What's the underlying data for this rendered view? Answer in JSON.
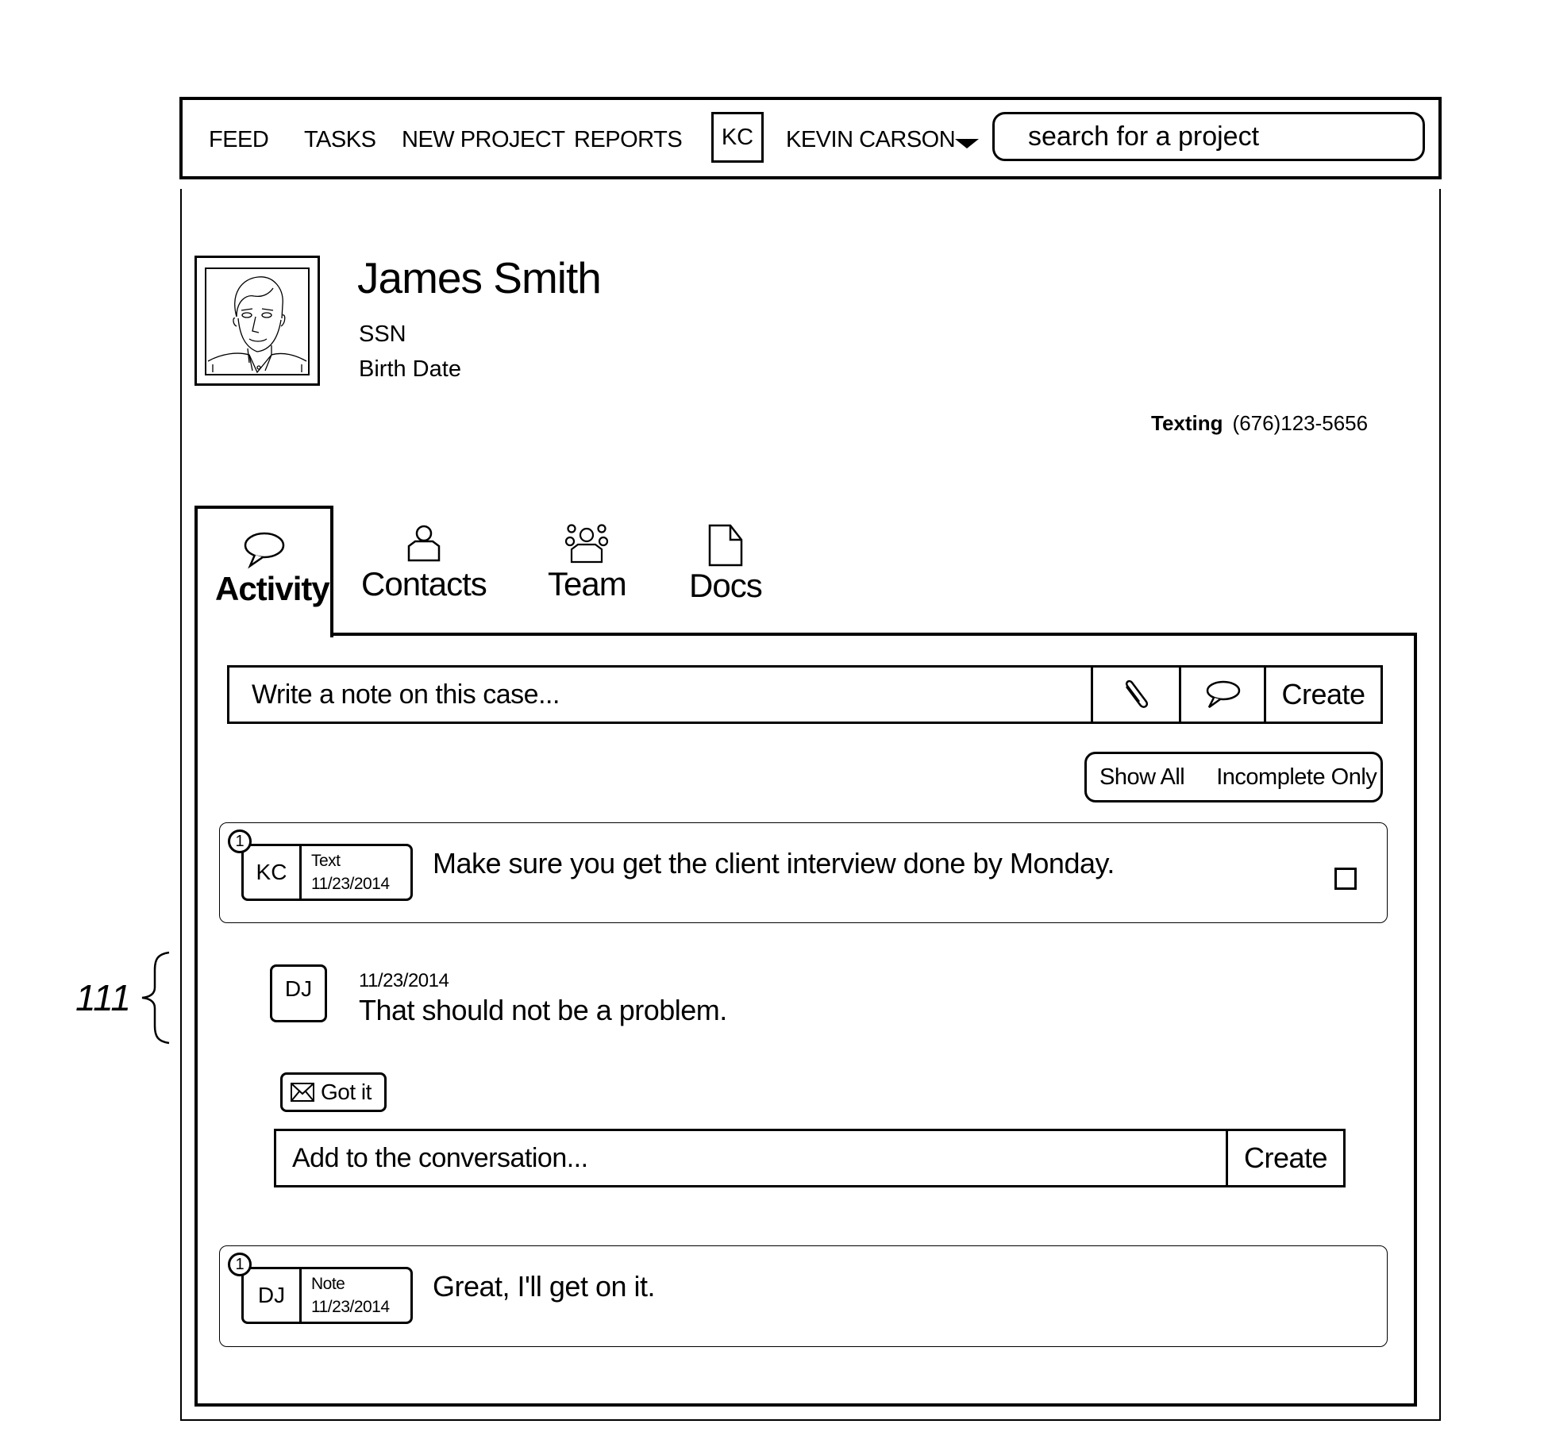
{
  "nav": {
    "items": [
      {
        "label": "FEED"
      },
      {
        "label": "TASKS"
      },
      {
        "label": "NEW PROJECT"
      },
      {
        "label": "REPORTS"
      }
    ],
    "user_initials": "KC",
    "user_name": "KEVIN CARSON",
    "user_menu_icon": "caret-down-icon",
    "search_placeholder": "search for a project"
  },
  "profile": {
    "name": "James Smith",
    "ssn_label": "SSN",
    "birth_date_label": "Birth Date",
    "avatar_icon": "person-portrait",
    "contact_method": "Texting",
    "phone": "(676)123-5656"
  },
  "tabs": [
    {
      "label": "Activity",
      "icon": "speech-bubble-icon",
      "active": true
    },
    {
      "label": "Contacts",
      "icon": "person-icon",
      "active": false
    },
    {
      "label": "Team",
      "icon": "group-icon",
      "active": false
    },
    {
      "label": "Docs",
      "icon": "document-icon",
      "active": false
    }
  ],
  "note": {
    "placeholder": "Write a note on this case...",
    "attach_icon": "paperclip-icon",
    "comment_icon": "speech-bubble-icon",
    "create_label": "Create"
  },
  "filter": {
    "show_all": "Show All",
    "incomplete_only": "Incomplete Only"
  },
  "activity": [
    {
      "count": "1",
      "initials": "KC",
      "type": "Text",
      "date": "11/23/2014",
      "message": "Make sure you get the client interview done by Monday.",
      "has_checkbox": true,
      "checked": false,
      "replies": [
        {
          "initials": "DJ",
          "date": "11/23/2014",
          "message": "That should not be a problem."
        }
      ],
      "ack_label": "Got it",
      "ack_icon": "envelope-icon",
      "reply_placeholder": "Add to the conversation...",
      "reply_create_label": "Create"
    },
    {
      "count": "1",
      "initials": "DJ",
      "type": "Note",
      "date": "11/23/2014",
      "message": "Great, I'll get on it."
    }
  ],
  "annotation": {
    "reference_label": "111"
  }
}
